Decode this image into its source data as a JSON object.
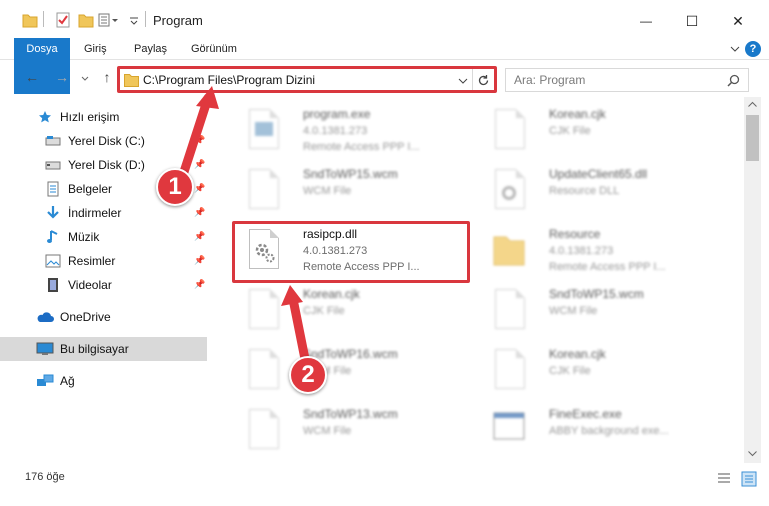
{
  "window": {
    "title": "Program",
    "minimize": "—",
    "maximize": "☐",
    "close": "✕"
  },
  "ribbon": {
    "tabs": [
      "Dosya",
      "Giriş",
      "Paylaş",
      "Görünüm"
    ]
  },
  "nav": {
    "address": "C:\\Program Files\\Program Dizini",
    "search_placeholder": "Ara: Program"
  },
  "sidebar": {
    "items": [
      {
        "label": "Hızlı erişim",
        "icon": "star-icon"
      },
      {
        "label": "Yerel Disk (C:)",
        "icon": "drive-icon"
      },
      {
        "label": "Yerel Disk (D:)",
        "icon": "drive-icon"
      },
      {
        "label": "Belgeler",
        "icon": "documents-icon"
      },
      {
        "label": "İndirmeler",
        "icon": "download-icon"
      },
      {
        "label": "Müzik",
        "icon": "music-icon"
      },
      {
        "label": "Resimler",
        "icon": "pictures-icon"
      },
      {
        "label": "Videolar",
        "icon": "video-icon"
      },
      {
        "label": "OneDrive",
        "icon": "cloud-icon"
      },
      {
        "label": "Bu bilgisayar",
        "icon": "computer-icon"
      },
      {
        "label": "Ağ",
        "icon": "network-icon"
      }
    ]
  },
  "files": [
    {
      "name": "program.exe",
      "line1": "4.0.1381.273",
      "line2": "Remote Access PPP I...",
      "icon": "exe-icon"
    },
    {
      "name": "Korean.cjk",
      "line1": "CJK File",
      "line2": "",
      "icon": "document-icon"
    },
    {
      "name": "SndToWP15.wcm",
      "line1": "WCM File",
      "line2": "",
      "icon": "document-icon"
    },
    {
      "name": "UpdateClient65.dll",
      "line1": "Resource DLL",
      "line2": "",
      "icon": "dll-icon"
    },
    {
      "name": "rasipcp.dll",
      "line1": "4.0.1381.273",
      "line2": "Remote Access PPP I...",
      "icon": "dll-icon"
    },
    {
      "name": "Resource",
      "line1": "4.0.1381.273",
      "line2": "Remote Access PPP I...",
      "icon": "folder-icon"
    },
    {
      "name": "Korean.cjk",
      "line1": "CJK File",
      "line2": "",
      "icon": "document-icon"
    },
    {
      "name": "SndToWP15.wcm",
      "line1": "WCM File",
      "line2": "",
      "icon": "document-icon"
    },
    {
      "name": "SndToWP16.wcm",
      "line1": "WCM File",
      "line2": "",
      "icon": "document-icon"
    },
    {
      "name": "Korean.cjk",
      "line1": "CJK File",
      "line2": "",
      "icon": "document-icon"
    },
    {
      "name": "SndToWP13.wcm",
      "line1": "WCM File",
      "line2": "",
      "icon": "document-icon"
    },
    {
      "name": "FineExec.exe",
      "line1": "ABBY background exe...",
      "line2": "",
      "icon": "app-window-icon"
    }
  ],
  "status": {
    "item_count": "176 öğe"
  },
  "annotations": {
    "badge1": "1",
    "badge2": "2"
  },
  "colors": {
    "accent": "#1979ca",
    "highlight": "#d9373e"
  }
}
